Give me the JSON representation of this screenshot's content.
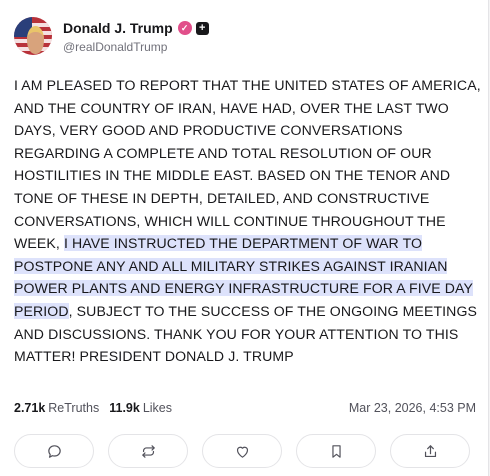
{
  "author": {
    "display_name": "Donald J. Trump",
    "handle": "@realDonaldTrump",
    "verified_icon": "check-badge-icon",
    "plus_icon": "plus-badge-icon",
    "verified_color": "#e14f8a"
  },
  "post": {
    "text_before": "I AM PLEASED TO REPORT THAT THE UNITED STATES OF AMERICA, AND THE COUNTRY OF IRAN, HAVE HAD, OVER THE LAST TWO DAYS, VERY GOOD AND PRODUCTIVE CONVERSATIONS REGARDING A COMPLETE AND TOTAL RESOLUTION OF OUR HOSTILITIES IN THE MIDDLE EAST. BASED ON THE TENOR AND TONE OF THESE IN DEPTH, DETAILED, AND CONSTRUCTIVE CONVERSATIONS, WHICH WILL CONTINUE THROUGHOUT THE WEEK, ",
    "text_highlighted": "I HAVE INSTRUCTED THE DEPARTMENT OF WAR TO POSTPONE ANY AND ALL MILITARY STRIKES AGAINST IRANIAN POWER PLANTS AND ENERGY INFRASTRUCTURE FOR A FIVE DAY PERIOD",
    "text_after": ", SUBJECT TO THE SUCCESS OF THE ONGOING MEETINGS AND DISCUSSIONS. THANK YOU FOR YOUR ATTENTION TO THIS MATTER! PRESIDENT DONALD J. TRUMP",
    "highlight_color": "#dde2fb"
  },
  "stats": {
    "retruths_count": "2.71k",
    "retruths_label": "ReTruths",
    "likes_count": "11.9k",
    "likes_label": "Likes",
    "timestamp": "Mar 23, 2026, 4:53 PM"
  },
  "actions": [
    "reply-icon",
    "retruth-icon",
    "like-icon",
    "bookmark-icon",
    "share-icon"
  ]
}
